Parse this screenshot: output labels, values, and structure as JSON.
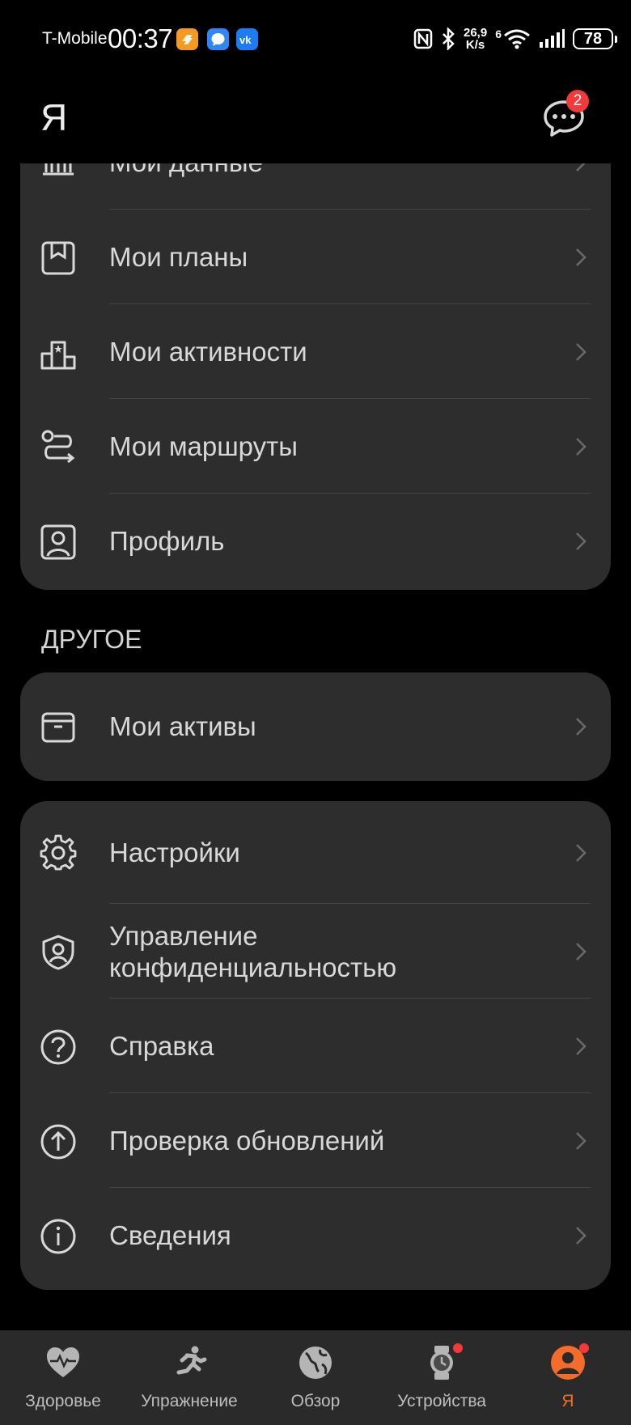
{
  "status_bar": {
    "carrier": "T-Mobile",
    "time": "00:37",
    "speed_value": "26,9",
    "speed_unit": "K/s",
    "battery": "78",
    "network": "6"
  },
  "header": {
    "title": "Я",
    "messages_badge": "2"
  },
  "group_top": {
    "items": [
      {
        "label": "Мои данные",
        "icon": "data-bars-icon"
      },
      {
        "label": "Мои планы",
        "icon": "bookmark-icon"
      },
      {
        "label": "Мои активности",
        "icon": "podium-icon"
      },
      {
        "label": "Мои маршруты",
        "icon": "route-icon"
      },
      {
        "label": "Профиль",
        "icon": "profile-icon"
      }
    ]
  },
  "section_other": {
    "title": "ДРУГОЕ",
    "items": [
      {
        "label": "Мои активы",
        "icon": "box-icon"
      }
    ]
  },
  "group_settings": {
    "items": [
      {
        "label": "Настройки",
        "icon": "gear-icon"
      },
      {
        "label": "Управление конфиденциальностью",
        "icon": "shield-user-icon"
      },
      {
        "label": "Справка",
        "icon": "help-icon"
      },
      {
        "label": "Проверка обновлений",
        "icon": "update-icon"
      },
      {
        "label": "Сведения",
        "icon": "info-icon"
      }
    ]
  },
  "bottom_nav": {
    "items": [
      {
        "label": "Здоровье",
        "icon": "heart-icon"
      },
      {
        "label": "Упражнение",
        "icon": "running-icon"
      },
      {
        "label": "Обзор",
        "icon": "globe-icon"
      },
      {
        "label": "Устройства",
        "icon": "watch-icon"
      },
      {
        "label": "Я",
        "icon": "me-icon"
      }
    ],
    "active_index": 4,
    "active_color": "#f36c2b"
  }
}
